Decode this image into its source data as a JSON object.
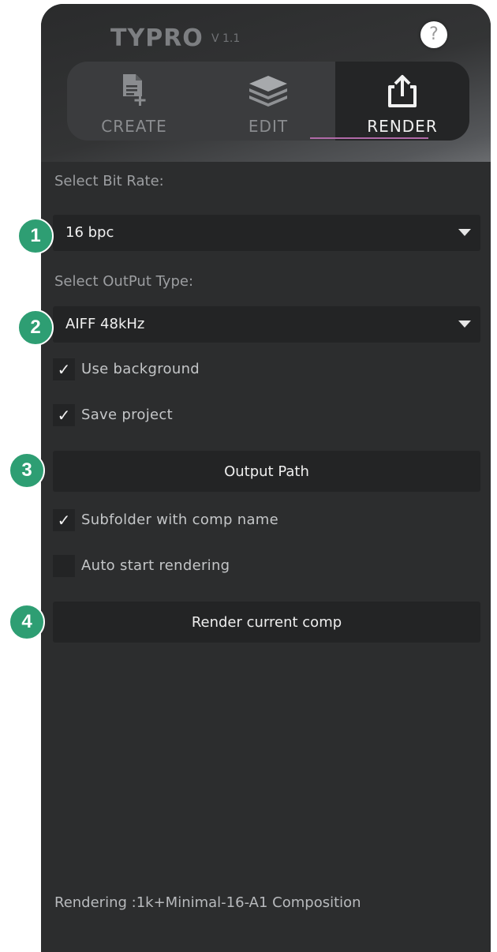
{
  "header": {
    "logo": "TYPRO",
    "version": "V 1.1",
    "help_icon": "?"
  },
  "tabs": [
    {
      "label": "CREATE",
      "icon": "document-add-icon",
      "active": false
    },
    {
      "label": "EDIT",
      "icon": "layers-icon",
      "active": false
    },
    {
      "label": "RENDER",
      "icon": "share-export-icon",
      "active": true
    }
  ],
  "bit_rate": {
    "label": "Select Bit Rate:",
    "selected": "16 bpc"
  },
  "output_type": {
    "label": "Select OutPut Type:",
    "selected": "AIFF 48kHz"
  },
  "options": {
    "use_background": {
      "label": "Use background",
      "checked": true,
      "mark": "✓"
    },
    "save_project": {
      "label": "Save project",
      "checked": true,
      "mark": "✓"
    },
    "subfolder": {
      "label": "Subfolder with comp name",
      "checked": true,
      "mark": "✓"
    },
    "auto_start": {
      "label": "Auto start rendering",
      "checked": false,
      "mark": ""
    }
  },
  "buttons": {
    "output_path": "Output Path",
    "render_current": "Render current comp"
  },
  "steps": [
    "1",
    "2",
    "3",
    "4"
  ],
  "status": "Rendering :1k+Minimal-16-A1  Composition",
  "colors": {
    "panel": "#2c2d2e",
    "accent_badge": "#2e9e73",
    "tab_underline": "#b06aa8"
  }
}
